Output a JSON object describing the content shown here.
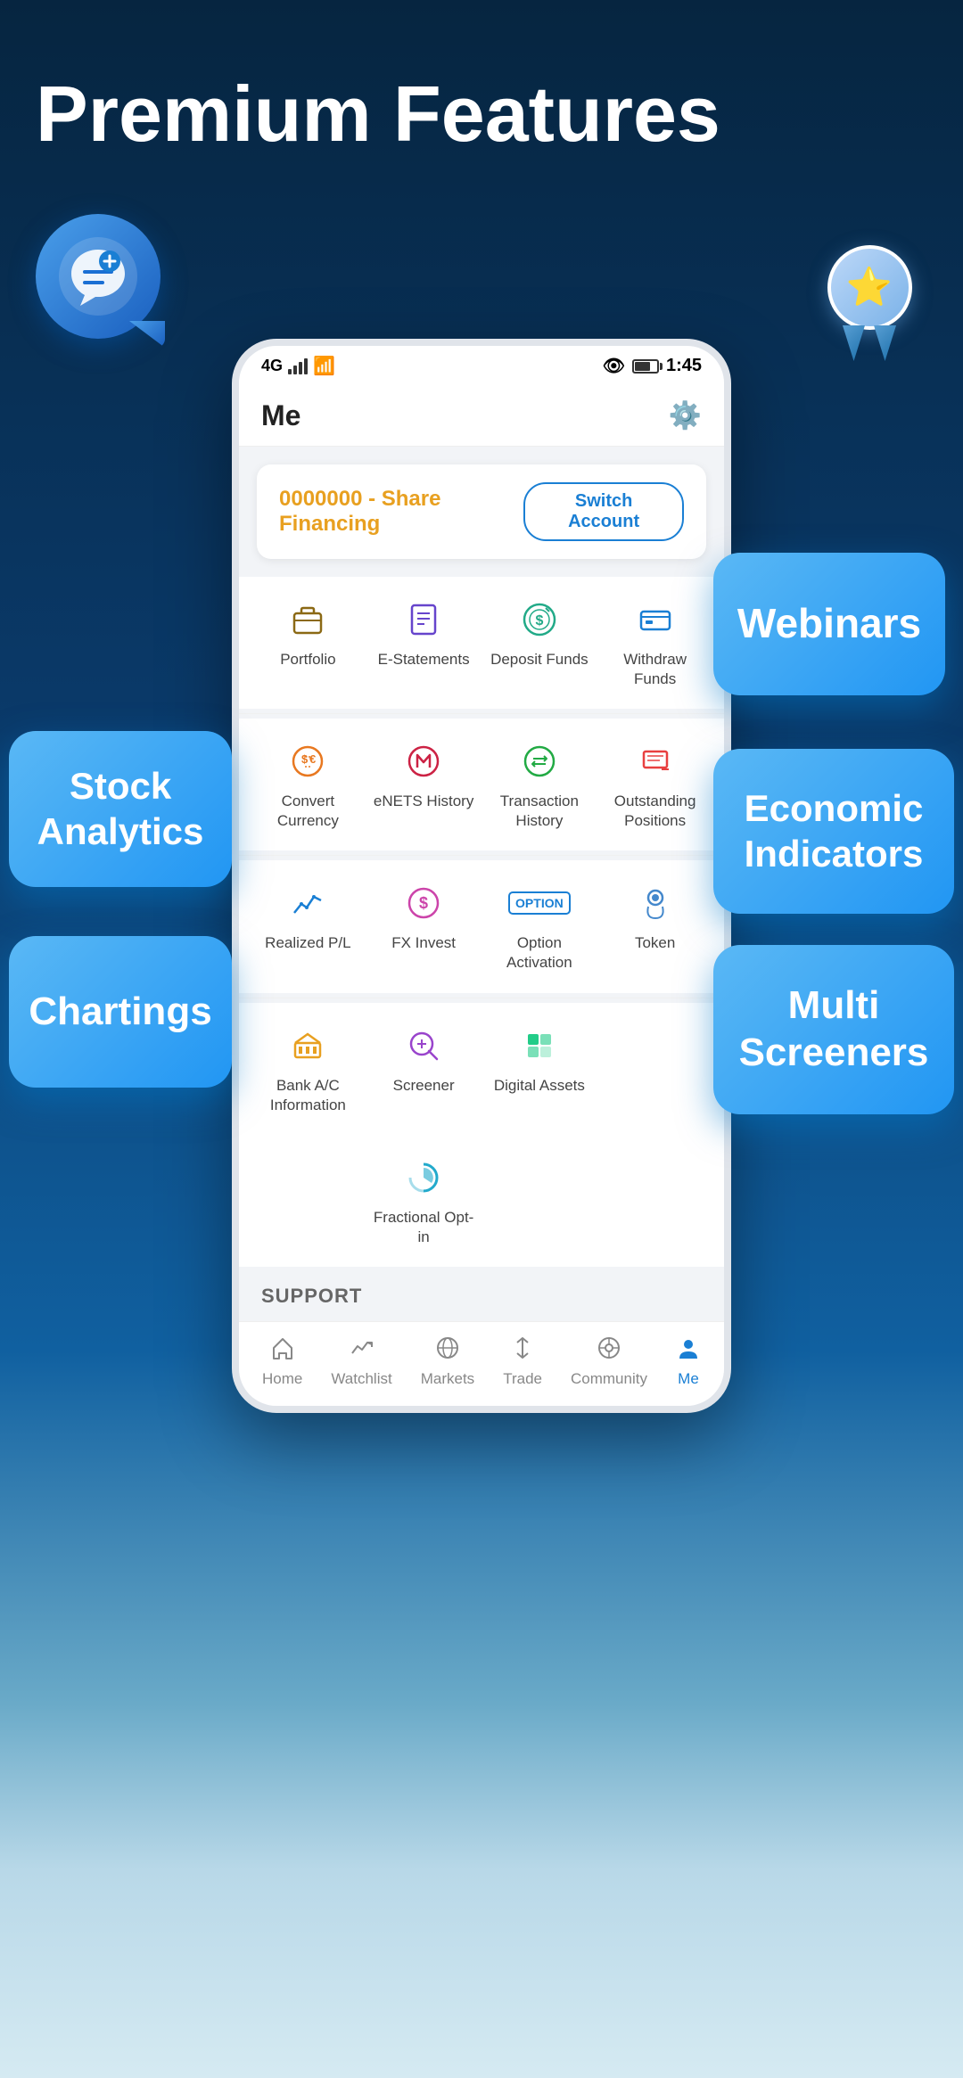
{
  "header": {
    "title": "Premium Features"
  },
  "status_bar": {
    "carrier": "4G",
    "time": "1:45",
    "wifi": true
  },
  "app": {
    "screen_title": "Me",
    "account": {
      "name": "0000000 - Share Financing",
      "switch_label": "Switch Account"
    }
  },
  "menu_rows": [
    [
      {
        "icon": "💼",
        "label": "Portfolio",
        "color": "#8B6914"
      },
      {
        "icon": "📋",
        "label": "E-Statements",
        "color": "#6644cc"
      },
      {
        "icon": "💵",
        "label": "Deposit Funds",
        "color": "#22aa88"
      },
      {
        "icon": "🏧",
        "label": "Withdraw Funds",
        "color": "#1a7fd4"
      }
    ],
    [
      {
        "icon": "💱",
        "label": "Convert Currency",
        "color": "#e87820"
      },
      {
        "icon": "🔄",
        "label": "eNETS History",
        "color": "#cc2244"
      },
      {
        "icon": "↔️",
        "label": "Transaction History",
        "color": "#22aa44"
      },
      {
        "icon": "📊",
        "label": "Outstanding Positions",
        "color": "#e84040"
      }
    ],
    [
      {
        "icon": "📈",
        "label": "Realized P/L",
        "color": "#1a7fd4"
      },
      {
        "icon": "💹",
        "label": "FX Invest",
        "color": "#cc44aa"
      },
      {
        "icon": "OPTION",
        "label": "Option Activation",
        "color": "#1a7fd4"
      },
      {
        "icon": "🪙",
        "label": "Token",
        "color": "#4488cc"
      }
    ],
    [
      {
        "icon": "🏦",
        "label": "Bank A/C Information",
        "color": "#e8a020"
      },
      {
        "icon": "🔍",
        "label": "Screener",
        "color": "#9944cc"
      },
      {
        "icon": "💎",
        "label": "Digital Assets",
        "color": "#22cc88"
      },
      {
        "icon": "",
        "label": "",
        "color": "transparent"
      }
    ],
    [
      {
        "icon": "",
        "label": "",
        "color": "transparent"
      },
      {
        "icon": "📊",
        "label": "Fractional Opt-in",
        "color": "#22aacc"
      },
      {
        "icon": "",
        "label": "",
        "color": "transparent"
      },
      {
        "icon": "",
        "label": "",
        "color": "transparent"
      }
    ]
  ],
  "support_label": "SUPPORT",
  "bottom_nav": [
    {
      "icon": "🏠",
      "label": "Home",
      "active": false
    },
    {
      "icon": "📊",
      "label": "Watchlist",
      "active": false
    },
    {
      "icon": "🌐",
      "label": "Markets",
      "active": false
    },
    {
      "icon": "↕️",
      "label": "Trade",
      "active": false
    },
    {
      "icon": "⭕",
      "label": "Community",
      "active": false
    },
    {
      "icon": "👤",
      "label": "Me",
      "active": true
    }
  ],
  "bubbles": {
    "webinars": "Webinars",
    "stock_analytics": "Stock Analytics",
    "economic_indicators": "Economic Indicators",
    "chartings": "Chartings",
    "multi_screeners": "Multi Screeners"
  }
}
